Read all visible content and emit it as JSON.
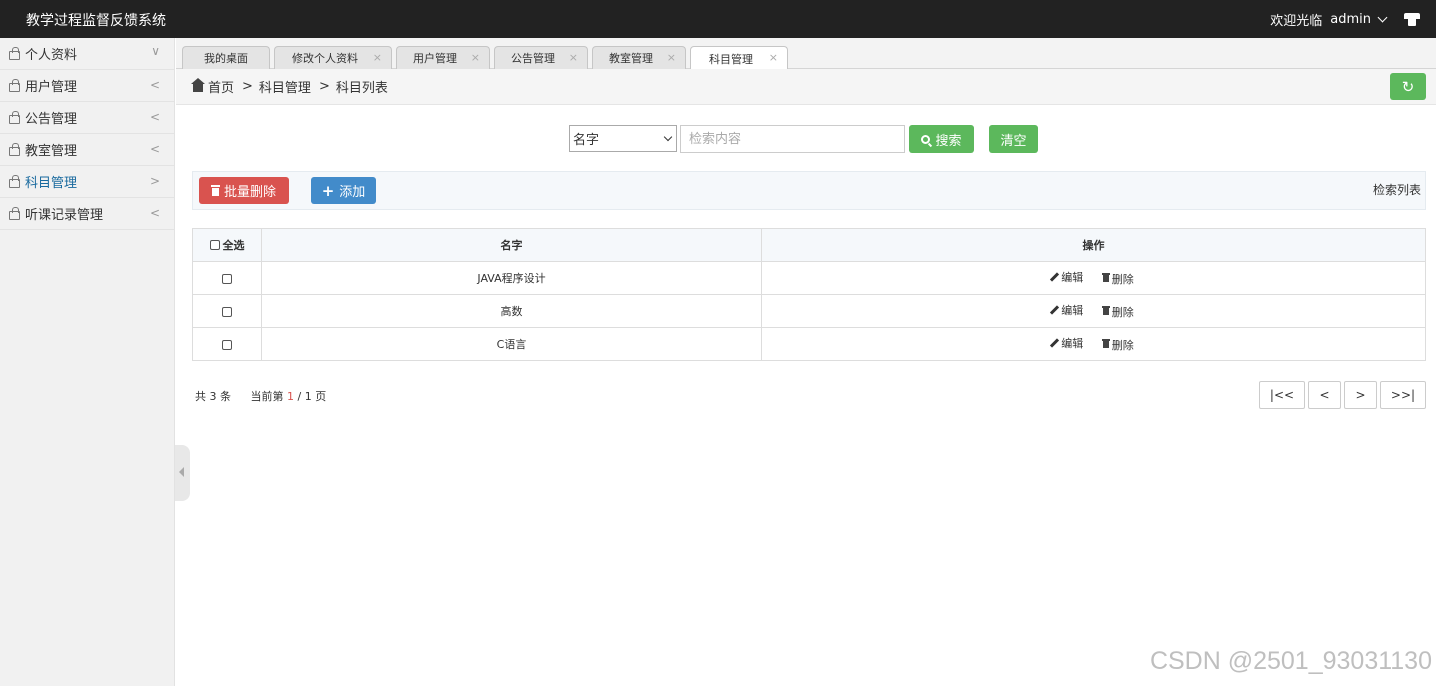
{
  "header": {
    "app_title": "教学过程监督反馈系统",
    "welcome": "欢迎光临",
    "username": "admin",
    "icons": [
      "chevron-down-icon",
      "tshirt-icon"
    ]
  },
  "sidebar": {
    "items": [
      {
        "label": "个人资料",
        "arrow": "∨"
      },
      {
        "label": "用户管理",
        "arrow": "<"
      },
      {
        "label": "公告管理",
        "arrow": "<"
      },
      {
        "label": "教室管理",
        "arrow": "<"
      },
      {
        "label": "科目管理",
        "arrow": ">"
      },
      {
        "label": "听课记录管理",
        "arrow": "<"
      }
    ],
    "active_color": "#18699e"
  },
  "tabs": [
    {
      "label": "我的桌面",
      "close": ""
    },
    {
      "label": "修改个人资料",
      "close": "×"
    },
    {
      "label": "用户管理",
      "close": "×"
    },
    {
      "label": "公告管理",
      "close": "×"
    },
    {
      "label": "教室管理",
      "close": "×"
    },
    {
      "label": "科目管理",
      "close": "×"
    }
  ],
  "breadcrumb": {
    "home": "首页",
    "sep": ">",
    "level1": "科目管理",
    "level2": "科目列表",
    "refresh": "↻"
  },
  "search": {
    "select_value": "名字",
    "placeholder": "检索内容",
    "search_label": "搜索",
    "clear_label": "清空"
  },
  "toolbar": {
    "batch_delete": "批量删除",
    "add": "添加",
    "list_label": "检索列表",
    "colors": {
      "danger": "#d9534f",
      "primary": "#428bca",
      "success": "#5cb85c"
    }
  },
  "table": {
    "select_all": "全选",
    "col_name": "名字",
    "col_ops": "操作",
    "edit_label": "编辑",
    "delete_label": "删除",
    "rows": [
      {
        "name": "JAVA程序设计"
      },
      {
        "name": "高数"
      },
      {
        "name": "C语言"
      }
    ]
  },
  "pagination": {
    "total_prefix": "共",
    "total": "3",
    "total_suffix": "条",
    "current_prefix": "当前第",
    "current": "1",
    "slash": "/",
    "pages": "1",
    "pages_suffix": "页",
    "first": "|<<",
    "prev": "<",
    "next": ">",
    "last": ">>|"
  },
  "watermark": "CSDN @2501_93031130"
}
